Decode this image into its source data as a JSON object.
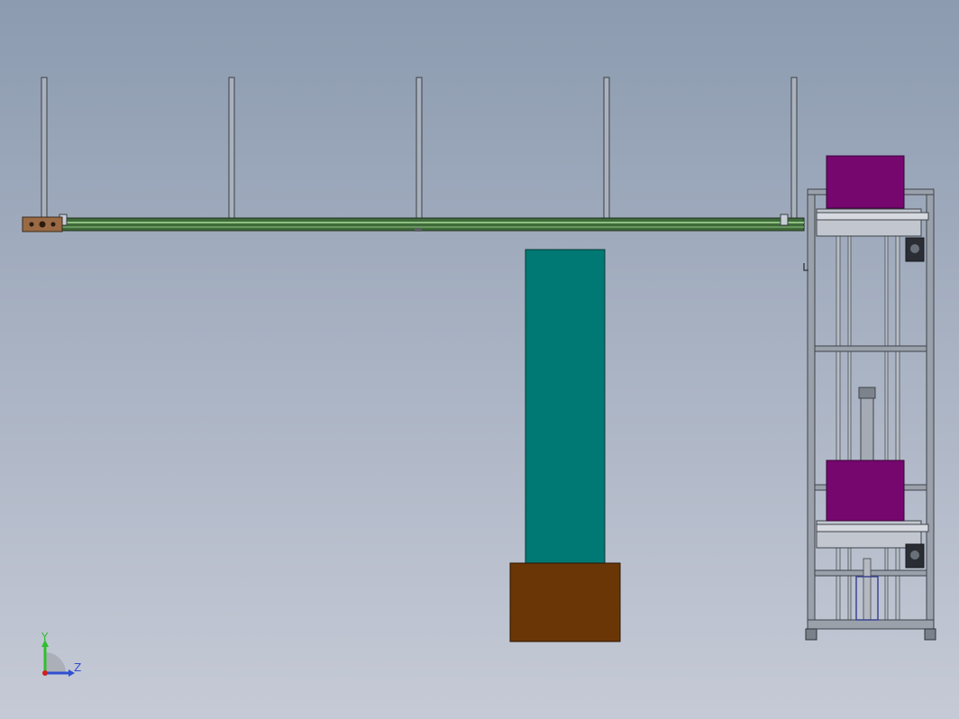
{
  "viewport": {
    "background_top": "#8c9bb0",
    "background_bottom": "#c6cad6"
  },
  "colors": {
    "rail_green": "#3f6b3a",
    "rail_light": "#8fbf80",
    "post_fill": "#a9b1bc",
    "post_stroke": "#3a3f46",
    "bracket_brown": "#9a6a45",
    "teal_box": "#007873",
    "brown_base": "#6b3606",
    "magenta_box": "#75076f",
    "frame_gray": "#9aa1ab",
    "frame_dark": "#3e434a"
  },
  "triad": {
    "y_label": "Y",
    "z_label": "Z",
    "y_color": "#2fbf2f",
    "z_color": "#3050d0",
    "origin_color": "#d02020"
  }
}
